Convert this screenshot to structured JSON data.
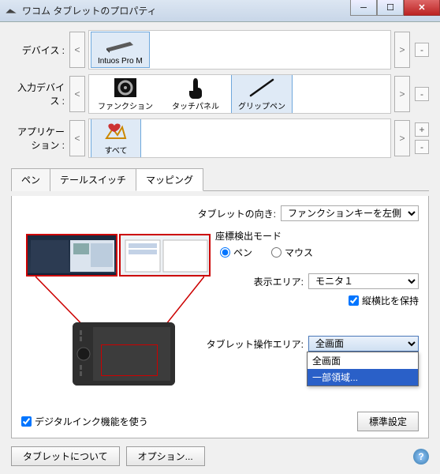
{
  "window": {
    "title": "ワコム タブレットのプロパティ"
  },
  "selectors": {
    "device": {
      "label": "デバイス :",
      "items": [
        "Intuos Pro M"
      ],
      "selected": 0
    },
    "input": {
      "label": "入力デバイス :",
      "items": [
        "ファンクション",
        "タッチパネル",
        "グリップペン"
      ],
      "selected": 2
    },
    "app": {
      "label": "アプリケーション :",
      "items": [
        "すべて"
      ],
      "selected": 0
    }
  },
  "tabs": [
    "ペン",
    "テールスイッチ",
    "マッピング"
  ],
  "active_tab": 2,
  "mapping": {
    "orientation": {
      "label": "タブレットの向き:",
      "value": "ファンクションキーを左側"
    },
    "mode": {
      "label": "座標検出モード",
      "options": [
        "ペン",
        "マウス"
      ],
      "selected": 0
    },
    "display_area": {
      "label": "表示エリア:",
      "value": "モニタ１"
    },
    "keep_aspect": "縦横比を保持",
    "tablet_area": {
      "label": "タブレット操作エリア:",
      "value": "全画面",
      "options": [
        "全画面",
        "一部領域..."
      ],
      "highlighted": 1
    },
    "digital_ink": "デジタルインク機能を使う",
    "defaults_btn": "標準設定"
  },
  "footer": {
    "about": "タブレットについて",
    "options": "オプション..."
  }
}
